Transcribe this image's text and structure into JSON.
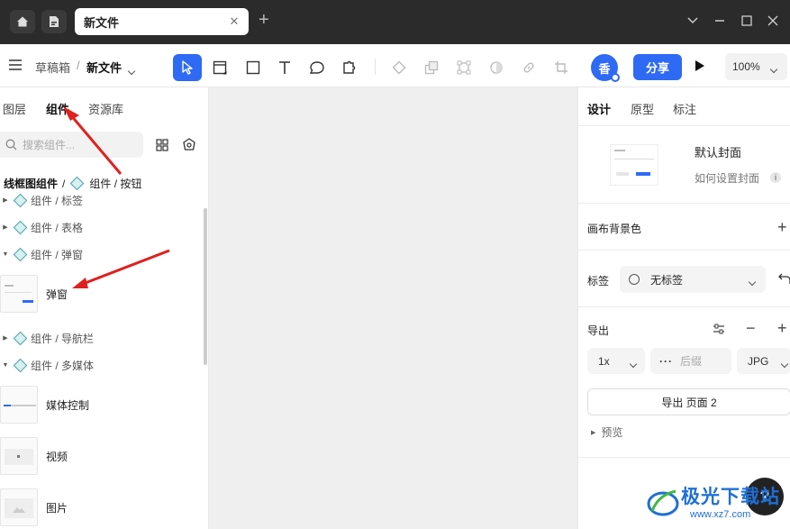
{
  "titlebar": {
    "tab_title": "新文件",
    "tab_close": "✕",
    "add_tab": "+"
  },
  "toolbar": {
    "breadcrumb_parent": "草稿箱",
    "breadcrumb_sep": "/",
    "file_name": "新文件",
    "avatar_text": "香",
    "share_label": "分享",
    "zoom_level": "100%"
  },
  "left_panel": {
    "tabs": [
      "图层",
      "组件",
      "资源库"
    ],
    "search_placeholder": "搜索组件...",
    "breadcrumb_root": "线框图组件",
    "breadcrumb_sep": "/",
    "breadcrumb_current": "组件 / 按钮",
    "tree": [
      {
        "label": "组件 / 标签",
        "expanded": false
      },
      {
        "label": "组件 / 表格",
        "expanded": false
      },
      {
        "label": "组件 / 弹窗",
        "expanded": true
      },
      {
        "label": "组件 / 导航栏",
        "expanded": false
      },
      {
        "label": "组件 / 多媒体",
        "expanded": true
      }
    ],
    "components": [
      "弹窗",
      "媒体控制",
      "视频",
      "图片"
    ]
  },
  "right_panel": {
    "tabs": [
      "设计",
      "原型",
      "标注"
    ],
    "cover_title": "默认封面",
    "cover_help": "如何设置封面",
    "canvas_bg_label": "画布背景色",
    "tag_label": "标签",
    "tag_value": "无标签",
    "export_label": "导出",
    "export_scale": "1x",
    "export_suffix_placeholder": "后缀",
    "export_format": "JPG",
    "export_button": "导出 页面 2",
    "preview_label": "预览"
  },
  "watermark": {
    "text": "极光下载站",
    "url": "www.xz7.com"
  },
  "help_label": "?",
  "colors": {
    "accent": "#2f6af5",
    "annotation_arrow": "#e02020"
  }
}
